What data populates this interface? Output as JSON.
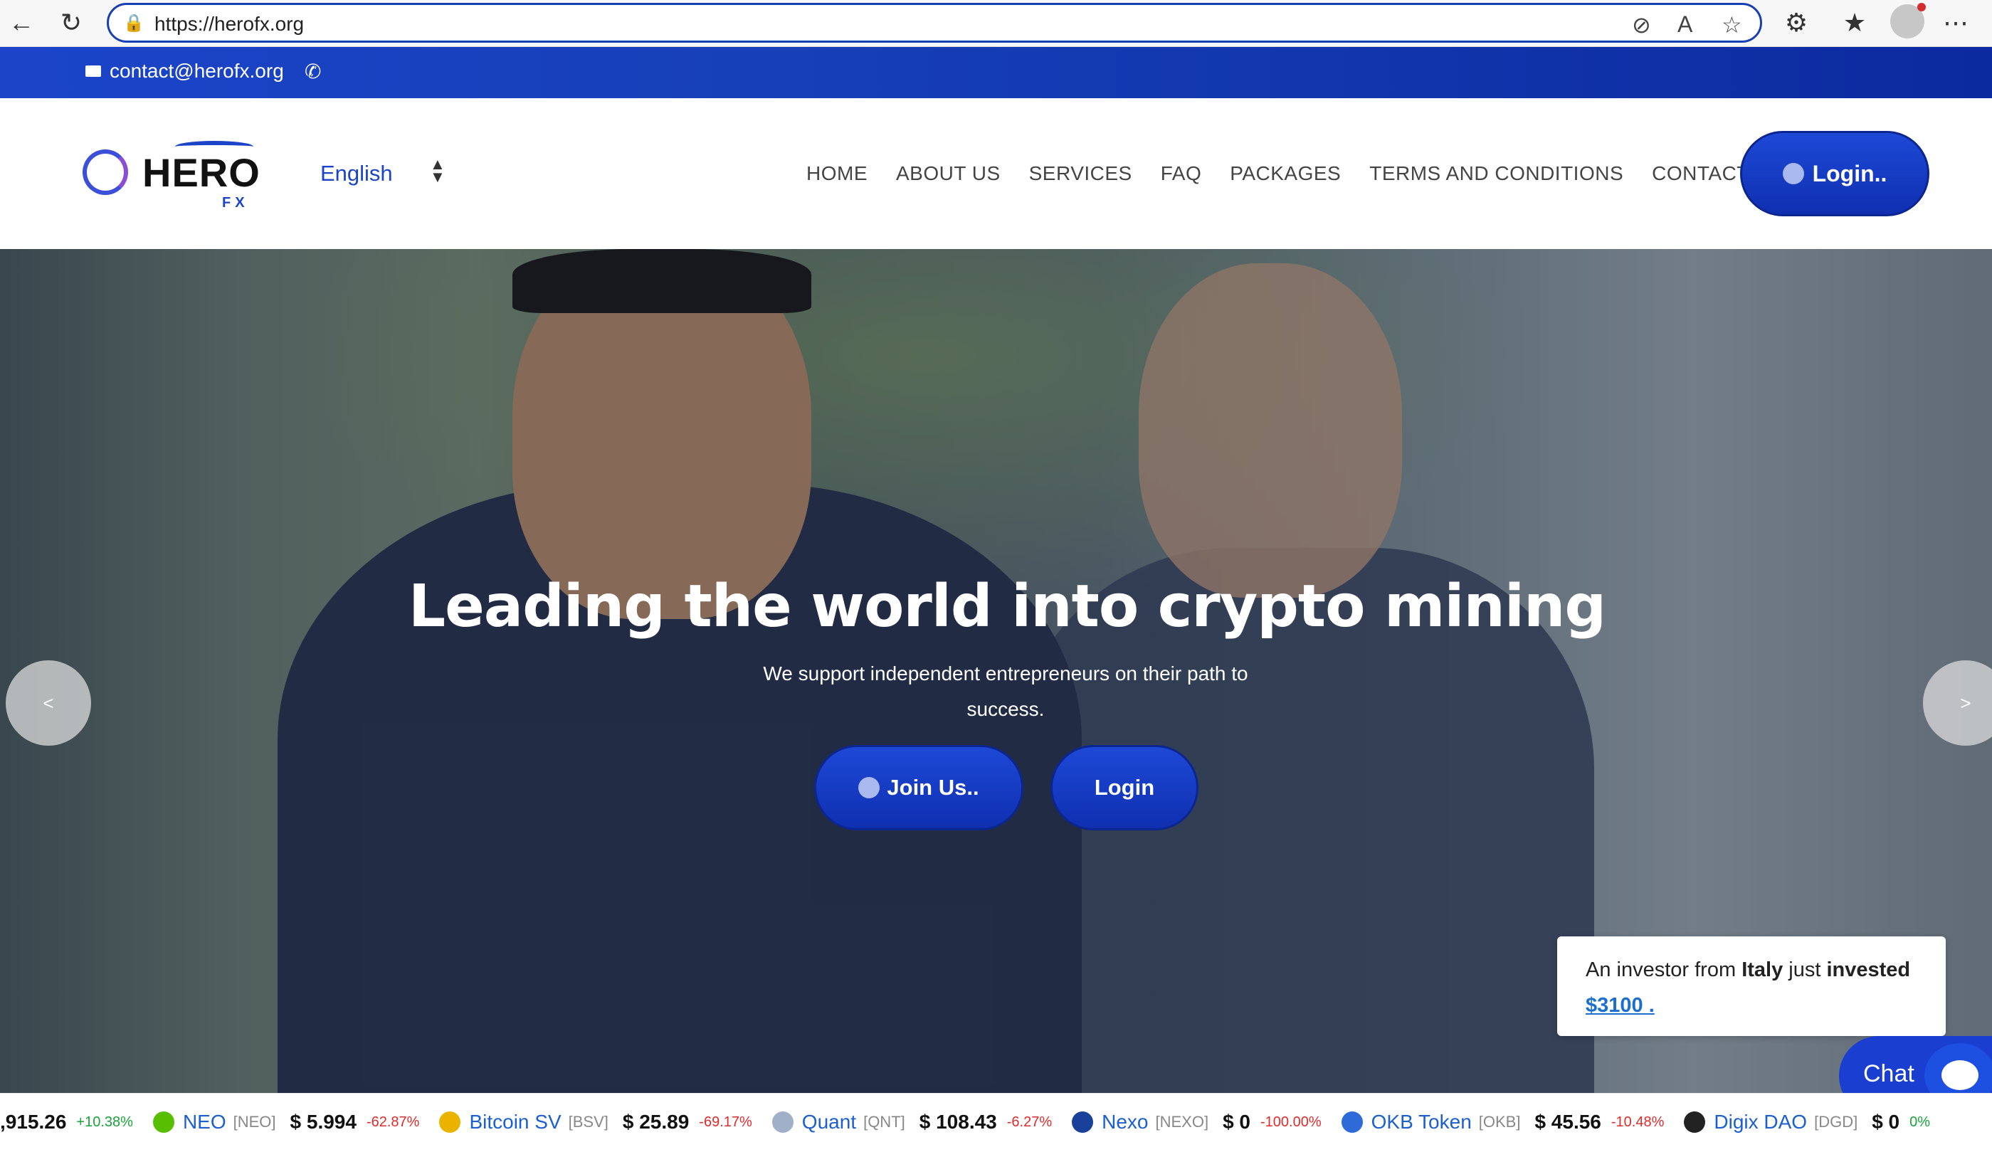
{
  "browser": {
    "url": "https://herofx.org"
  },
  "topbar": {
    "email": "contact@herofx.org"
  },
  "header": {
    "logo_text": "HERO",
    "logo_sub": "FX",
    "language": "English",
    "nav": [
      "HOME",
      "ABOUT US",
      "SERVICES",
      "FAQ",
      "PACKAGES",
      "TERMS AND CONDITIONS",
      "CONTACT US"
    ],
    "login_label": "Login.."
  },
  "hero": {
    "title": "Leading the world into crypto mining",
    "subtitle": "We support independent entrepreneurs on their path to success.",
    "join_label": "Join Us..",
    "login_label": "Login",
    "prev_label": "<",
    "next_label": ">"
  },
  "notification": {
    "prefix": "An investor from ",
    "country": "Italy",
    "middle": " just ",
    "action": "invested",
    "amount": "$3100 ."
  },
  "chat": {
    "label": "Chat"
  },
  "ticker": [
    {
      "name": "",
      "symbol": "",
      "price": ",915.26",
      "change": "+10.38%",
      "direction": "up",
      "icon_color": ""
    },
    {
      "name": "NEO",
      "symbol": "[NEO]",
      "price": "$ 5.994",
      "change": "-62.87%",
      "direction": "down",
      "icon_color": "#58bf00"
    },
    {
      "name": "Bitcoin SV",
      "symbol": "[BSV]",
      "price": "$ 25.89",
      "change": "-69.17%",
      "direction": "down",
      "icon_color": "#eab300"
    },
    {
      "name": "Quant",
      "symbol": "[QNT]",
      "price": "$ 108.43",
      "change": "-6.27%",
      "direction": "down",
      "icon_color": "#9fb0c8"
    },
    {
      "name": "Nexo",
      "symbol": "[NEXO]",
      "price": "$ 0",
      "change": "-100.00%",
      "direction": "down",
      "icon_color": "#1a4199"
    },
    {
      "name": "OKB Token",
      "symbol": "[OKB]",
      "price": "$ 45.56",
      "change": "-10.48%",
      "direction": "down",
      "icon_color": "#2f6bd8"
    },
    {
      "name": "Digix DAO",
      "symbol": "[DGD]",
      "price": "$ 0",
      "change": "0%",
      "direction": "up",
      "icon_color": "#222222"
    }
  ]
}
